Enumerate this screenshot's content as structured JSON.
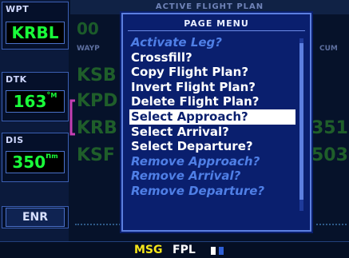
{
  "left_panel": {
    "wpt": {
      "label": "WPT",
      "value": "KRBL"
    },
    "dtk": {
      "label": "DTK",
      "value": "163",
      "unit_top": "°",
      "unit_bottom": "M"
    },
    "dis": {
      "label": "DIS",
      "value": "350",
      "unit_top": "n",
      "unit_bottom": "m"
    },
    "mode": "ENR"
  },
  "background_page": {
    "title": "ACTIVE FLIGHT PLAN",
    "rows": [
      "KSB",
      "KPD",
      "KRB",
      "KSF"
    ],
    "right_values": [
      "351",
      "503"
    ],
    "top_left_fragment": "00",
    "col_header_left": "WAYP",
    "col_header_right": "CUM"
  },
  "page_menu": {
    "title": "PAGE MENU",
    "items": [
      {
        "label": "Activate Leg?",
        "state": "disabled"
      },
      {
        "label": "Crossfill?",
        "state": "enabled"
      },
      {
        "label": "Copy Flight Plan?",
        "state": "enabled"
      },
      {
        "label": "Invert Flight Plan?",
        "state": "enabled"
      },
      {
        "label": "Delete Flight Plan?",
        "state": "enabled"
      },
      {
        "label": "Select Approach?",
        "state": "selected"
      },
      {
        "label": "Select Arrival?",
        "state": "enabled"
      },
      {
        "label": "Select Departure?",
        "state": "enabled"
      },
      {
        "label": "Remove Approach?",
        "state": "disabled"
      },
      {
        "label": "Remove Arrival?",
        "state": "disabled"
      },
      {
        "label": "Remove Departure?",
        "state": "disabled"
      }
    ]
  },
  "status_bar": {
    "msg": "MSG",
    "fpl": "FPL"
  },
  "colors": {
    "accent_green": "#19ff3a",
    "msg_yellow": "#f6e619",
    "popup_blue": "#0a1f6e",
    "selection": "#ffffff"
  }
}
